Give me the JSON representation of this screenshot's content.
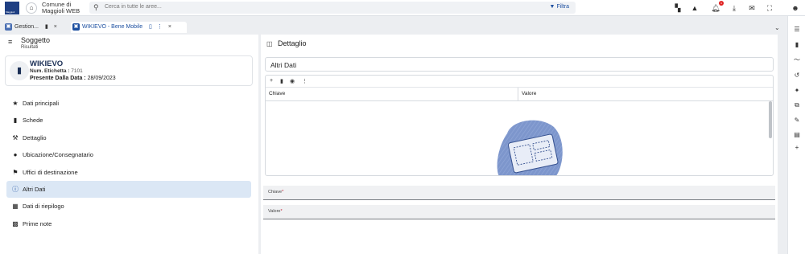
{
  "header": {
    "app_title_line1": "Comune di",
    "app_title_line2": "Maggioli WEB",
    "logo_text": "Maggioli",
    "search_placeholder": "Cerca in tutte le aree...",
    "filter_label": "Filtra",
    "notifications_count": "1"
  },
  "tabs": [
    {
      "label": "Gestion...",
      "active": false
    },
    {
      "label": "WIKIEVO - Bene Mobile",
      "active": true
    }
  ],
  "left": {
    "title": "Soggetto",
    "subtitle": "Risultati",
    "card": {
      "name": "WIKIEVO",
      "label_etichetta": "Num. Etichetta :",
      "value_etichetta": "7101",
      "label_data": "Presente Dalla Data :",
      "value_data": "28/09/2023"
    },
    "nav": [
      {
        "label": "Dati principali",
        "icon": "star-icon"
      },
      {
        "label": "Schede",
        "icon": "file-icon"
      },
      {
        "label": "Dettaglio",
        "icon": "magic-wand-icon"
      },
      {
        "label": "Ubicazione/Consegnatario",
        "icon": "person-icon"
      },
      {
        "label": "Uffici di destinazione",
        "icon": "location-pin-icon"
      },
      {
        "label": "Altri Dati",
        "icon": "info-icon",
        "active": true
      },
      {
        "label": "Dati di riepilogo",
        "icon": "calculator-icon"
      },
      {
        "label": "Prime note",
        "icon": "table-icon"
      }
    ]
  },
  "main": {
    "title": "Dettaglio",
    "section_title": "Altri Dati",
    "grid": {
      "columns": [
        "Chiave",
        "Valore"
      ]
    },
    "fields": [
      {
        "label": "Chiave",
        "required_mark": "*"
      },
      {
        "label": "Valore",
        "required_mark": "*"
      }
    ]
  },
  "colors": {
    "accent": "#1c4fa0",
    "active_row": "#dbe7f5",
    "required": "#c0182b",
    "notification": "#e02020"
  }
}
